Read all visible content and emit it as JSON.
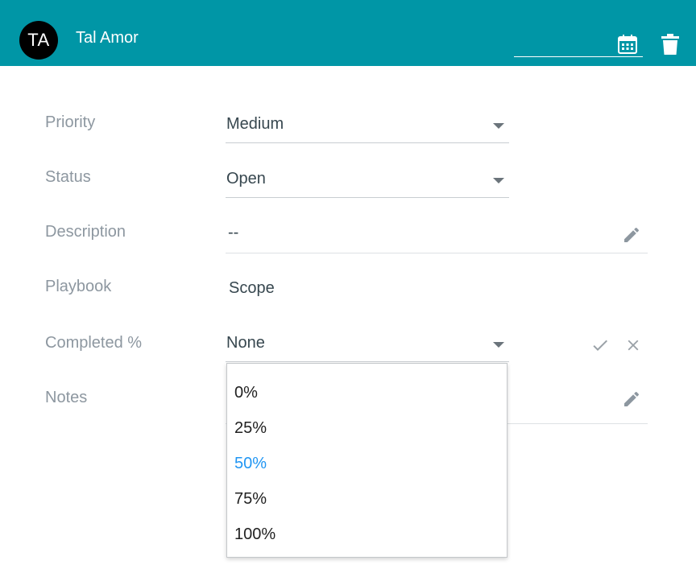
{
  "header": {
    "avatar_initials": "TA",
    "user_name": "Tal Amor",
    "date_value": "",
    "icons": {
      "calendar": "calendar-icon",
      "delete": "trash-icon"
    },
    "background_color": "#0096a6"
  },
  "fields": {
    "priority": {
      "label": "Priority",
      "value": "Medium"
    },
    "status": {
      "label": "Status",
      "value": "Open"
    },
    "description": {
      "label": "Description",
      "value": "--"
    },
    "playbook": {
      "label": "Playbook",
      "value": "Scope"
    },
    "completed": {
      "label": "Completed %",
      "value": "None"
    },
    "notes": {
      "label": "Notes",
      "value": ""
    }
  },
  "completed_dropdown": {
    "options": [
      "0%",
      "25%",
      "50%",
      "75%",
      "100%"
    ],
    "highlighted": "50%",
    "highlight_color": "#2196f3"
  }
}
